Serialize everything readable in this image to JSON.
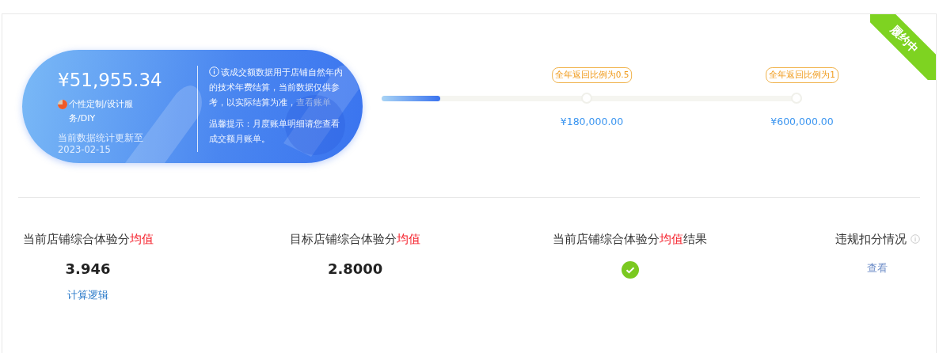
{
  "status_ribbon": "履约中",
  "summary": {
    "amount": "¥51,955.34",
    "category": "个性定制/设计服务/DIY",
    "updated": "当前数据统计更新至2023-02-15",
    "notice": "该成交额数据用于店铺自然年内的技术年费结算，当前数据仅供参考，以实际结算为准，",
    "notice_link": "查看账单",
    "tip": "温馨提示：月度账单明细请您查看成交额月账单。"
  },
  "progress": {
    "level": 0.14,
    "milestones": [
      {
        "label": "全年返回比例为0.5",
        "amount": "¥180,000.00"
      },
      {
        "label": "全年返回比例为1",
        "amount": "¥600,000.00"
      }
    ]
  },
  "stats": [
    {
      "kind": "value",
      "title": [
        {
          "text": "当前店铺综合体验分",
          "highlight": false
        },
        {
          "text": "均值",
          "highlight": true
        }
      ],
      "value": "3.946",
      "link": "计算逻辑"
    },
    {
      "kind": "value",
      "title": [
        {
          "text": "目标店铺综合体验分",
          "highlight": false
        },
        {
          "text": "均值",
          "highlight": true
        }
      ],
      "value": "2.8000"
    },
    {
      "kind": "check",
      "title": [
        {
          "text": "当前店铺综合体验分",
          "highlight": false
        },
        {
          "text": "均值",
          "highlight": true
        },
        {
          "text": "结果",
          "highlight": false
        }
      ]
    },
    {
      "kind": "link",
      "title": [
        {
          "text": "违规扣分情况",
          "highlight": false
        }
      ],
      "info": true,
      "link": "查看"
    }
  ]
}
